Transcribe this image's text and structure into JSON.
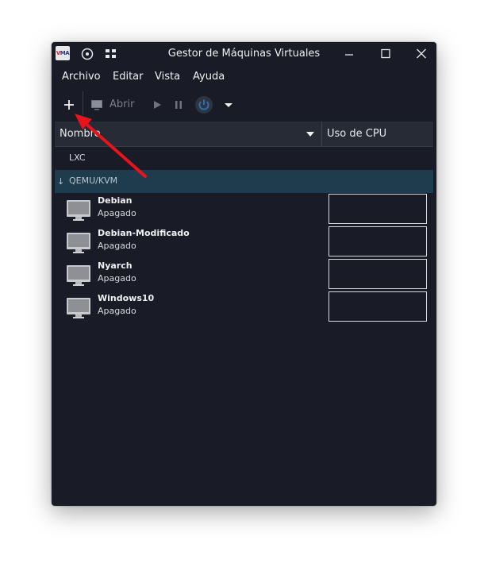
{
  "window": {
    "title": "Gestor de Máquinas Virtuales",
    "app_icon_text": "VMA"
  },
  "menu": {
    "items": [
      "Archivo",
      "Editar",
      "Vista",
      "Ayuda"
    ]
  },
  "toolbar": {
    "new_icon": "plus-icon",
    "open_label": "Abrir",
    "open_icon": "monitor-icon",
    "run_icon": "play-icon",
    "pause_icon": "pause-icon",
    "shutdown_icon": "power-icon",
    "dropdown_icon": "chevron-down-icon"
  },
  "table": {
    "columns": [
      "Nombre",
      "Uso de CPU"
    ],
    "sort_icon": "caret-down-icon"
  },
  "connections": [
    {
      "label": "LXC"
    },
    {
      "label": "QEMU/KVM"
    }
  ],
  "vms": [
    {
      "name": "Debian",
      "status": "Apagado"
    },
    {
      "name": "Debian-Modificado",
      "status": "Apagado"
    },
    {
      "name": "Nyarch",
      "status": "Apagado"
    },
    {
      "name": "Windows10",
      "status": "Apagado"
    }
  ],
  "colors": {
    "window_bg": "#191c27",
    "header_bg": "#272b36",
    "selected_bg": "#1f3b4e",
    "annotation_arrow": "#e8141c",
    "power_icon": "#2f6fa8"
  }
}
